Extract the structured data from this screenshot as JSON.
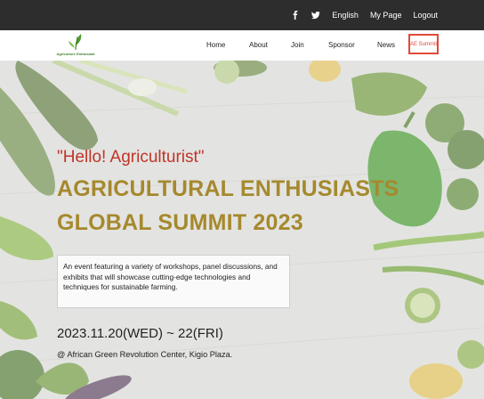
{
  "topbar": {
    "facebook_icon": "facebook-icon",
    "twitter_icon": "twitter-icon",
    "language": "English",
    "my_page": "My Page",
    "logout": "Logout"
  },
  "logo": {
    "text": "Agriculture Enthusiast"
  },
  "nav": {
    "home": "Home",
    "about": "About",
    "join": "Join",
    "sponsor": "Sponsor",
    "news": "News",
    "ae_summit": "AE Summit"
  },
  "colors": {
    "topbar_bg": "#2d2d2d",
    "greeting": "#c0342a",
    "title": "#a6892e",
    "active_nav": "#e04a3a"
  },
  "hero": {
    "greeting": "\"Hello! Agriculturist\"",
    "title_line1": "AGRICULTURAL ENTHUSIASTS",
    "title_line2": "GLOBAL SUMMIT 2023",
    "description": "An event featuring a variety of workshops, panel discussions, and exhibits that will showcase cutting-edge technologies and techniques for sustainable farming.",
    "date": "2023.11.20(WED) ~ 22(FRI)",
    "venue": "@ African Green Revolution Center, Kigio Plaza."
  }
}
